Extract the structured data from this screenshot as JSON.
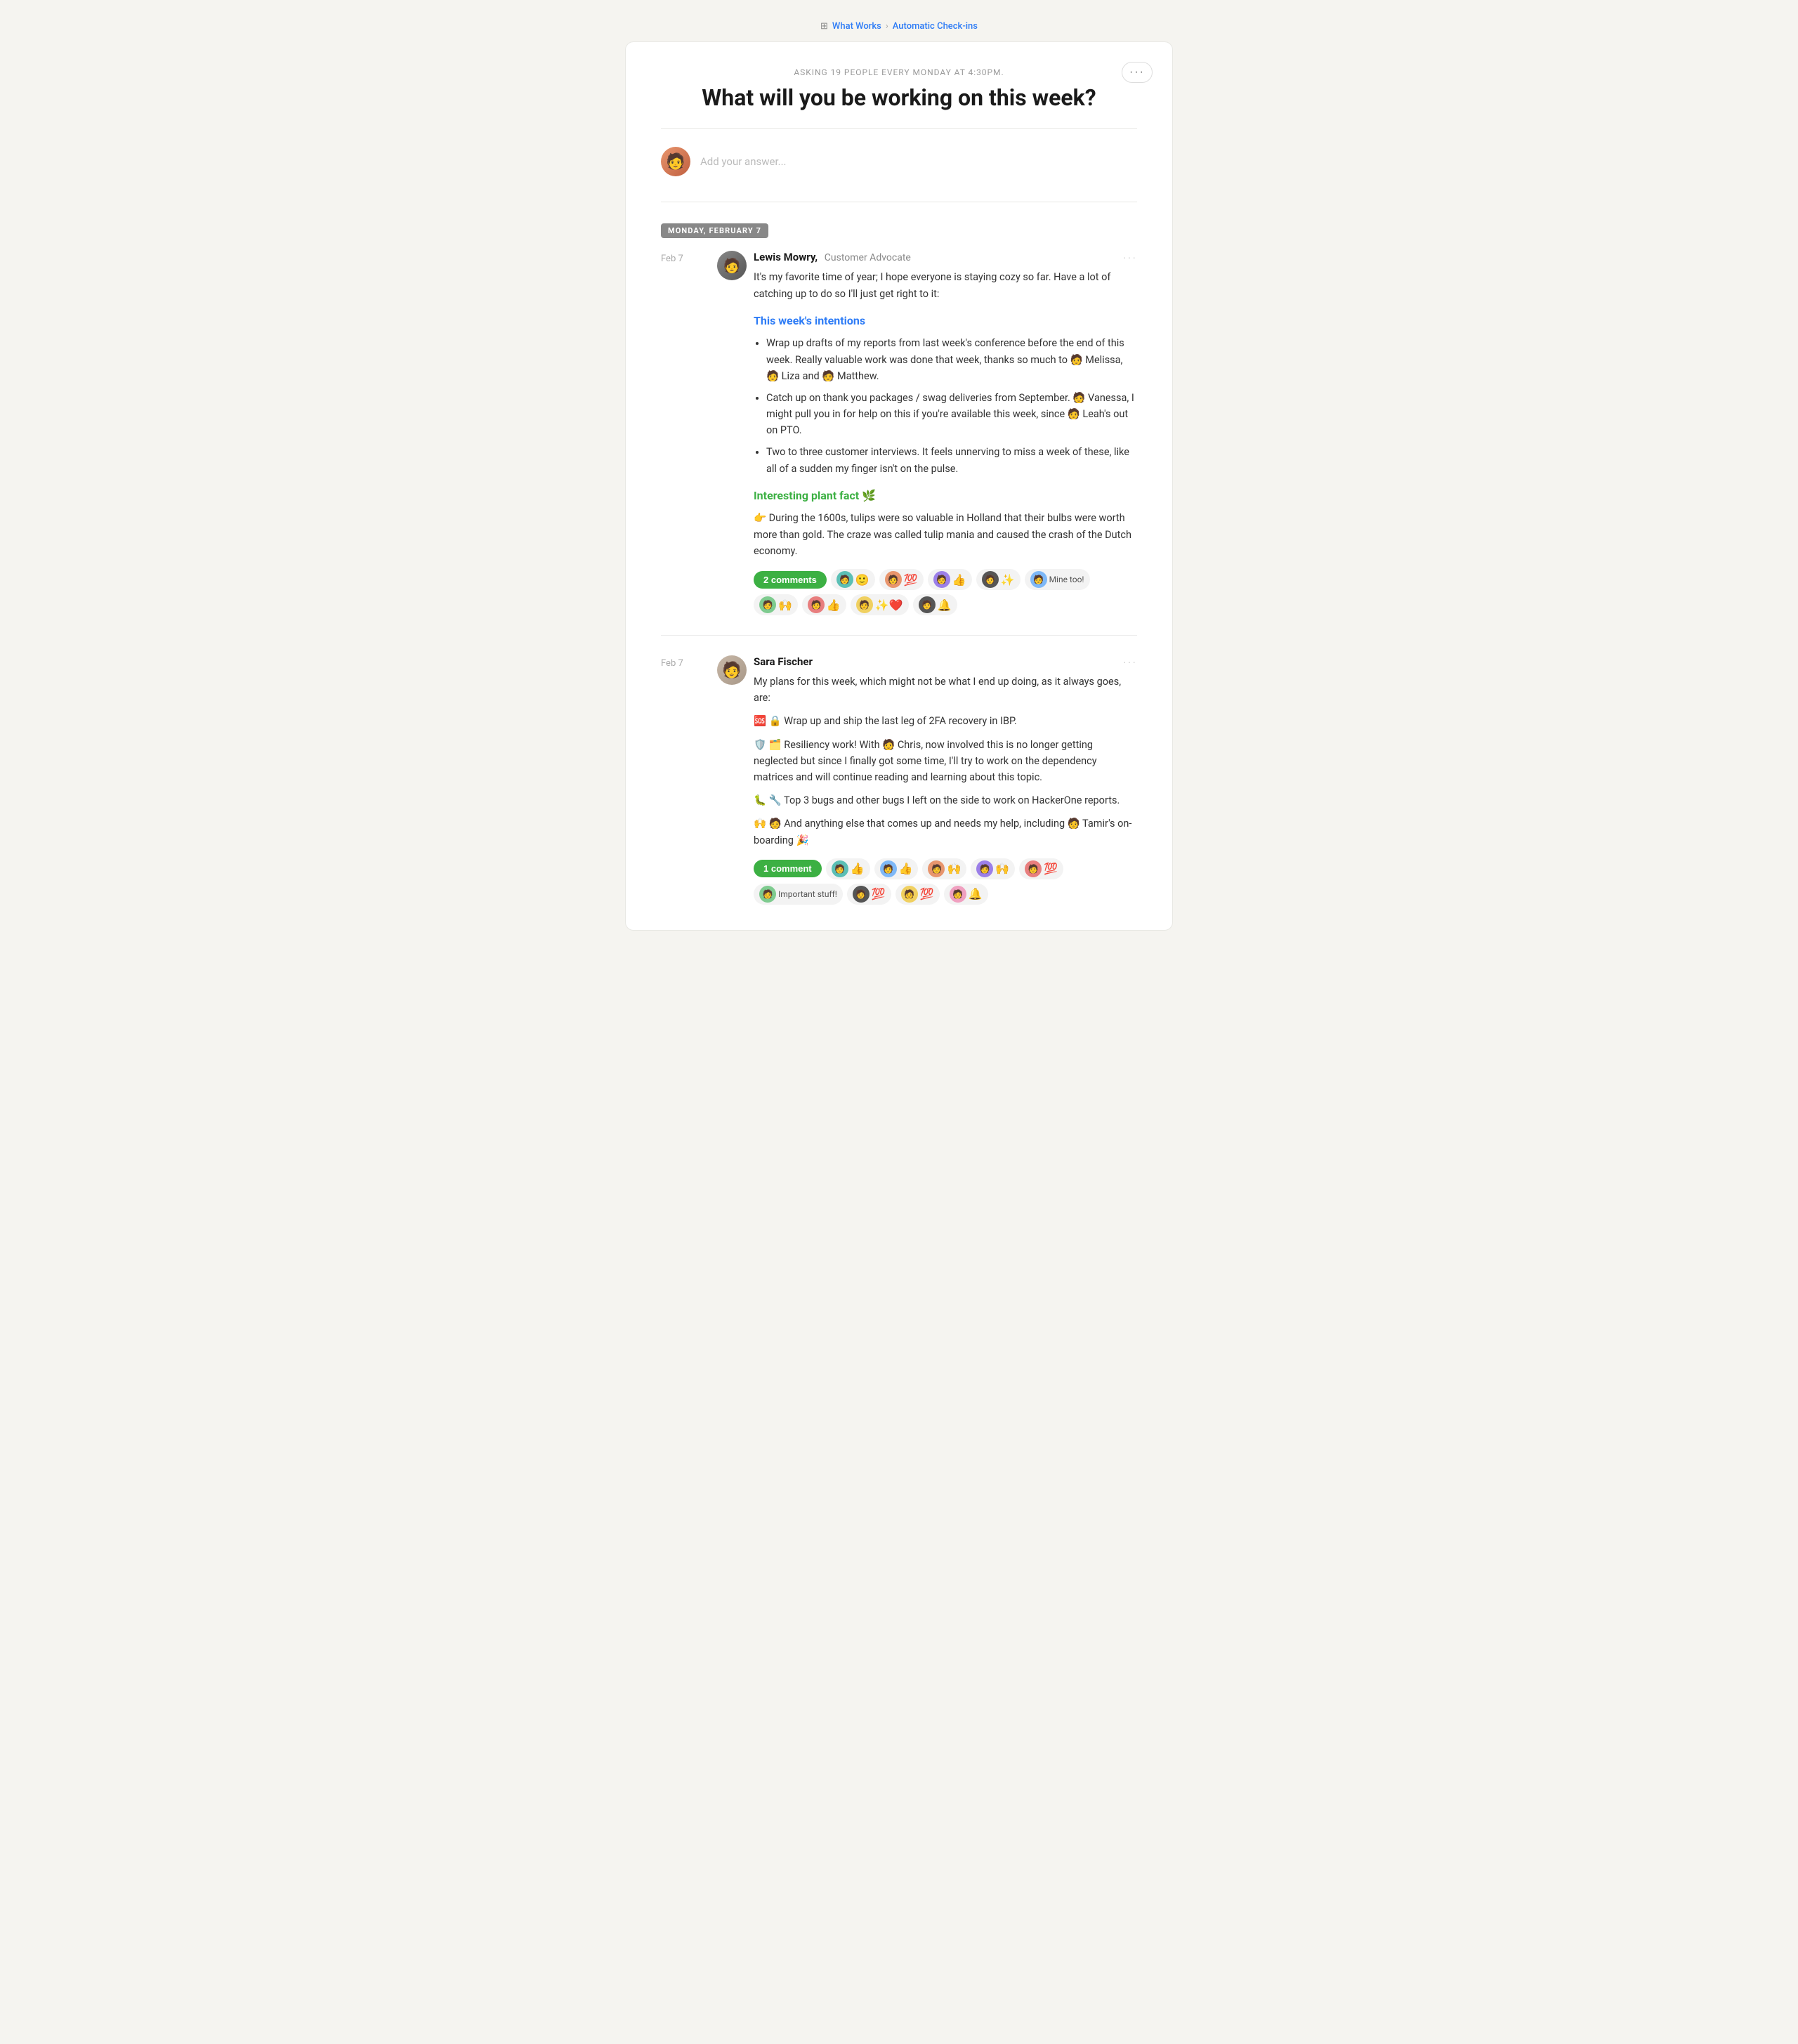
{
  "breadcrumb": {
    "icon": "⊞",
    "workspace": "What Works",
    "separator": "›",
    "section": "Automatic Check-ins"
  },
  "checkin": {
    "meta": "Asking 19 people every Monday at 4:30pm.",
    "title": "What will you be working on this week?",
    "more_button": "···",
    "add_placeholder": "Add your answer...",
    "date_label": "Monday, February 7"
  },
  "posts": [
    {
      "date": "Feb 7",
      "author": "Lewis Mowry,",
      "role": "Customer Advocate",
      "intro": "It's my favorite time of year; I hope everyone is staying cozy so far. Have a lot of catching up to do so I'll just get right to it:",
      "section1_heading": "This week's intentions",
      "bullets": [
        "Wrap up drafts of my reports from last week's conference before the end of this week. Really valuable work was done that week, thanks so much to 🧑 Melissa, 🧑 Liza and 🧑 Matthew.",
        "Catch up on thank you packages / swag deliveries from September. 🧑 Vanessa, I might pull you in for help on this if you're available this week, since 🧑 Leah's out on PTO.",
        "Two to three customer interviews. It feels unnerving to miss a week of these, like all of a sudden my finger isn't on the pulse."
      ],
      "section2_heading": "Interesting plant fact 🌿",
      "plant_fact": "👉 During the 1600s, tulips were so valuable in Holland that their bulbs were worth more than gold. The craze was called tulip mania and caused the crash of the Dutch economy.",
      "comments_label": "2 comments",
      "reactions": [
        {
          "type": "avatar_emoji",
          "emoji": "🙂"
        },
        {
          "type": "avatar_emoji",
          "emoji": "💯"
        },
        {
          "type": "avatar_emoji",
          "emoji": "👍"
        },
        {
          "type": "avatar_emoji",
          "emoji": "✨"
        },
        {
          "type": "text",
          "label": "Mine too!"
        },
        {
          "type": "avatar_emoji",
          "emoji": "🙌"
        },
        {
          "type": "avatar_emoji",
          "emoji": "👍"
        },
        {
          "type": "avatar_emoji",
          "emoji": "✨❤️"
        },
        {
          "type": "avatar_emoji",
          "emoji": "🔔"
        }
      ]
    },
    {
      "date": "Feb 7",
      "author": "Sara Fischer",
      "role": "",
      "intro": "My plans for this week, which might not be what I end up doing, as it always goes, are:",
      "lines": [
        "🆘 🔒 Wrap up and ship the last leg of 2FA recovery in IBP.",
        "🛡️ 🗂️ Resiliency work! With 🧑 Chris, now involved this is no longer getting neglected but since I finally got some time, I'll try to work on the dependency matrices and will continue reading and learning about this topic.",
        "🐛 🔧 Top 3 bugs and other bugs I left on the side to work on HackerOne reports.",
        "🙌 🧑 And anything else that comes up and needs my help, including 🧑 Tamir's on-boarding 🎉"
      ],
      "comments_label": "1 comment",
      "reactions": [
        {
          "type": "avatar_emoji",
          "emoji": "👍"
        },
        {
          "type": "avatar_emoji",
          "emoji": "👍"
        },
        {
          "type": "avatar_emoji",
          "emoji": "🙌"
        },
        {
          "type": "avatar_emoji",
          "emoji": "🙌"
        },
        {
          "type": "avatar_emoji",
          "emoji": "💯"
        },
        {
          "type": "text",
          "label": "Important stuff!"
        },
        {
          "type": "avatar_emoji",
          "emoji": "💯"
        },
        {
          "type": "avatar_emoji",
          "emoji": "💯"
        },
        {
          "type": "avatar_emoji",
          "emoji": "🔔"
        }
      ]
    }
  ]
}
